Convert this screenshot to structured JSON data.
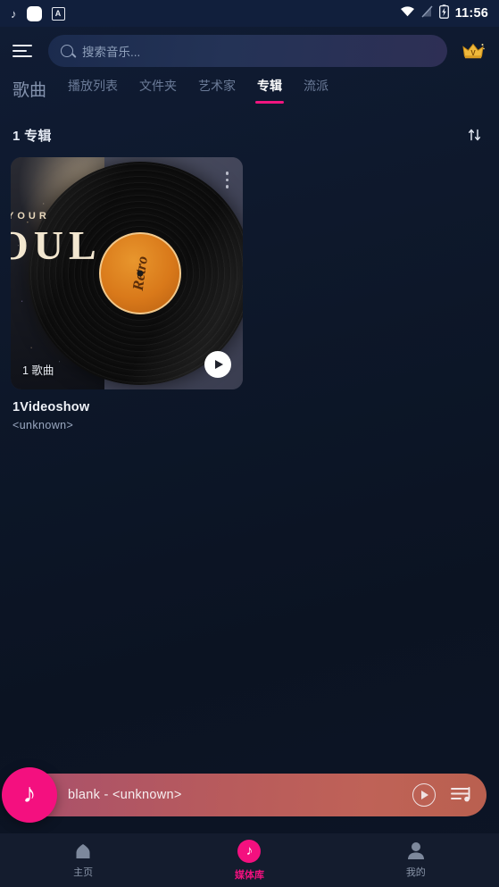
{
  "statusbar": {
    "music_icon": "music-note",
    "app_icon": "white-square",
    "alt_icon": "A",
    "wifi_icon": "wifi",
    "signal_icon": "signal-off",
    "battery_icon": "battery-charging",
    "time": "11:56"
  },
  "topbar": {
    "menu_icon": "hamburger-menu",
    "search_placeholder": "搜索音乐...",
    "search_value": "",
    "vip_icon": "crown"
  },
  "tabs": [
    {
      "label": "歌曲",
      "active": false
    },
    {
      "label": "播放列表",
      "active": false
    },
    {
      "label": "文件夹",
      "active": false
    },
    {
      "label": "艺术家",
      "active": false
    },
    {
      "label": "专辑",
      "active": true
    },
    {
      "label": "流派",
      "active": false
    }
  ],
  "section": {
    "count_label": "1 专辑",
    "sort_icon": "sort-arrows"
  },
  "albums": [
    {
      "title": "1Videoshow",
      "artist": "<unknown>",
      "songs_badge": "1 歌曲",
      "art_text_top": "YOUR",
      "art_text_main": "OUL",
      "vinyl_label": "Retro",
      "menu_icon": "more-vertical-icon",
      "play_icon": "play-icon"
    }
  ],
  "mini_player": {
    "note_icon": "music-note-icon",
    "now_playing": "blank - <unknown>",
    "play_icon": "play-circle-icon",
    "queue_icon": "queue-music-icon"
  },
  "bottom_nav": [
    {
      "label": "主页",
      "icon": "home-icon",
      "active": false
    },
    {
      "label": "媒体库",
      "icon": "library-music-icon",
      "active": true
    },
    {
      "label": "我的",
      "icon": "person-icon",
      "active": false
    }
  ],
  "colors": {
    "accent": "#f4107f",
    "background": "#0d1729",
    "statusbar": "#111f3c",
    "nav_bar": "#141c2e",
    "vinyl_label": "#d9791a"
  }
}
